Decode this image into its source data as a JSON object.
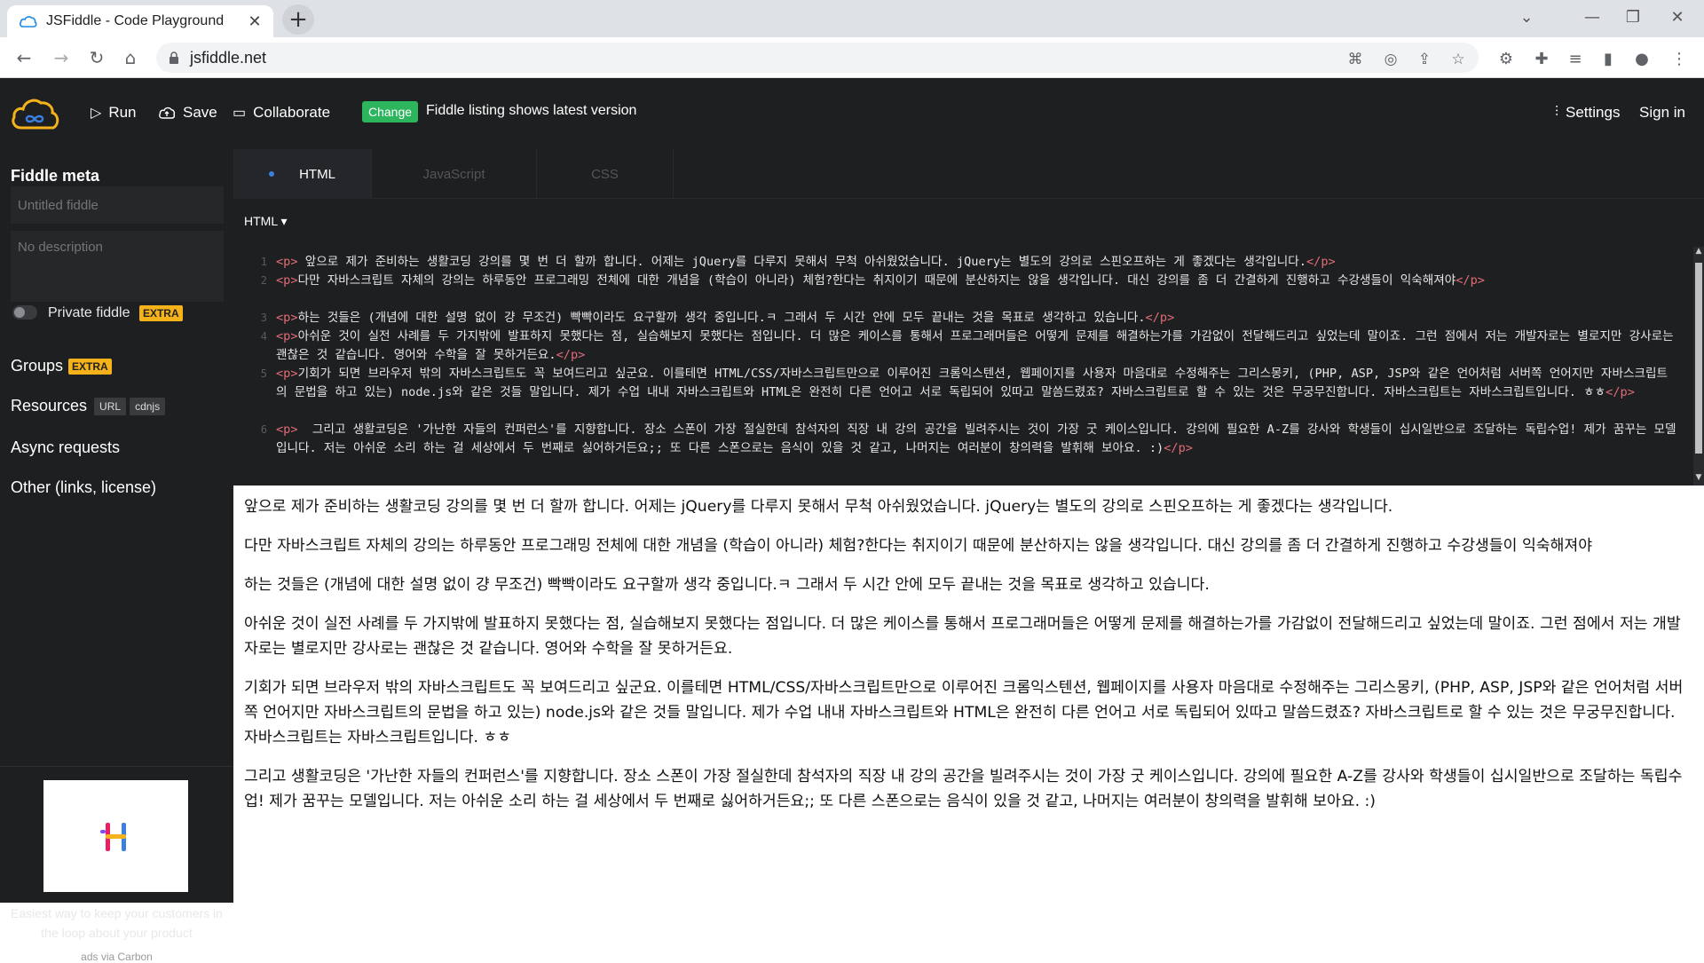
{
  "browser": {
    "tab_title": "JSFiddle - Code Playground",
    "url": "jsfiddle.net"
  },
  "topbar": {
    "run_label": "Run",
    "save_label": "Save",
    "collaborate_label": "Collaborate",
    "change_badge": "Change",
    "change_text": "Fiddle listing shows latest version",
    "settings_label": "Settings",
    "signin_label": "Sign in"
  },
  "sidebar": {
    "title": "Fiddle meta",
    "title_placeholder": "Untitled fiddle",
    "description_placeholder": "No description",
    "private_label": "Private fiddle",
    "extra_badge": "EXTRA",
    "groups_label": "Groups",
    "resources_label": "Resources",
    "resources_pills": [
      "URL",
      "cdnjs"
    ],
    "async_label": "Async requests",
    "other_label": "Other (links, license)",
    "ad_text": "Easiest way to keep your customers in the loop about your product",
    "ad_via": "ads via Carbon"
  },
  "editor": {
    "tabs": [
      "HTML",
      "JavaScript",
      "CSS"
    ],
    "language": "HTML ▾",
    "lines": [
      {
        "num": "1",
        "text": " 앞으로 제가 준비하는 생활코딩 강의를 몇 번 더 할까 합니다. 어제는 jQuery를 다루지 못해서 무척 아쉬웠었습니다. jQuery는 별도의 강의로 스핀오프하는 게 좋겠다는 생각입니다."
      },
      {
        "num": "2",
        "text": "다만 자바스크립트 자체의 강의는 하루동안 프로그래밍 전체에 대한 개념을 (학습이 아니라) 체험?한다는 취지이기 때문에 분산하지는 않을 생각입니다. 대신 강의를 좀 더 간결하게 진행하고 수강생들이 익숙해져야"
      },
      {
        "num": "3",
        "text": "하는 것들은 (개념에 대한 설명 없이 걍 무조건) 빡빡이라도 요구할까 생각 중입니다.ㅋ 그래서 두 시간 안에 모두 끝내는 것을 목표로 생각하고 있습니다."
      },
      {
        "num": "4",
        "text": "아쉬운 것이 실전 사례를 두 가지밖에 발표하지 못했다는 점, 실습해보지 못했다는 점입니다. 더 많은 케이스를 통해서 프로그래머들은 어떻게 문제를 해결하는가를 가감없이 전달해드리고 싶었는데 말이죠. 그런 점에서 저는 개발자로는 별로지만 강사로는 괜찮은 것 같습니다. 영어와 수학을 잘 못하거든요."
      },
      {
        "num": "5",
        "text": "기회가 되면 브라우저 밖의 자바스크립트도 꼭 보여드리고 싶군요. 이를테면 HTML/CSS/자바스크립트만으로 이루어진 크롬익스텐션, 웹페이지를 사용자 마음대로 수정해주는 그리스몽키, (PHP, ASP, JSP와 같은 언어처럼 서버쪽 언어지만 자바스크립트의 문법을 하고 있는) node.js와 같은 것들 말입니다. 제가 수업 내내 자바스크립트와 HTML은 완전히 다른 언어고 서로 독립되어 있따고 말씀드렸죠? 자바스크립트로 할 수 있는 것은 무궁무진합니다. 자바스크립트는 자바스크립트입니다. ㅎㅎ"
      },
      {
        "num": "6",
        "text": "  그리고 생활코딩은 '가난한 자들의 컨퍼런스'를 지향합니다. 장소 스폰이 가장 절실한데 참석자의 직장 내 강의 공간을 빌려주시는 것이 가장 굿 케이스입니다. 강의에 필요한 A-Z를 강사와 학생들이 십시일반으로 조달하는 독립수업! 제가 꿈꾸는 모델입니다. 저는 아쉬운 소리 하는 걸 세상에서 두 번째로 싫어하거든요;; 또 다른 스폰으로는 음식이 있을 것 같고, 나머지는 여러분이 창의력을 발휘해 보아요. :)"
      }
    ],
    "tag_open": "<p>",
    "tag_close": "</p>"
  },
  "result": {
    "paragraphs": [
      "앞으로 제가 준비하는 생활코딩 강의를 몇 번 더 할까 합니다. 어제는 jQuery를 다루지 못해서 무척 아쉬웠었습니다. jQuery는 별도의 강의로 스핀오프하는 게 좋겠다는 생각입니다.",
      "다만 자바스크립트 자체의 강의는 하루동안 프로그래밍 전체에 대한 개념을 (학습이 아니라) 체험?한다는 취지이기 때문에 분산하지는 않을 생각입니다. 대신 강의를 좀 더 간결하게 진행하고 수강생들이 익숙해져야",
      "하는 것들은 (개념에 대한 설명 없이 걍 무조건) 빡빡이라도 요구할까 생각 중입니다.ㅋ 그래서 두 시간 안에 모두 끝내는 것을 목표로 생각하고 있습니다.",
      "아쉬운 것이 실전 사례를 두 가지밖에 발표하지 못했다는 점, 실습해보지 못했다는 점입니다. 더 많은 케이스를 통해서 프로그래머들은 어떻게 문제를 해결하는가를 가감없이 전달해드리고 싶었는데 말이죠. 그런 점에서 저는 개발자로는 별로지만 강사로는 괜찮은 것 같습니다. 영어와 수학을 잘 못하거든요.",
      "기회가 되면 브라우저 밖의 자바스크립트도 꼭 보여드리고 싶군요. 이를테면 HTML/CSS/자바스크립트만으로 이루어진 크롬익스텐션, 웹페이지를 사용자 마음대로 수정해주는 그리스몽키, (PHP, ASP, JSP와 같은 언어처럼 서버쪽 언어지만 자바스크립트의 문법을 하고 있는) node.js와 같은 것들 말입니다. 제가 수업 내내 자바스크립트와 HTML은 완전히 다른 언어고 서로 독립되어 있따고 말씀드렸죠? 자바스크립트로 할 수 있는 것은 무궁무진합니다. 자바스크립트는 자바스크립트입니다. ㅎㅎ",
      "그리고 생활코딩은 '가난한 자들의 컨퍼런스'를 지향합니다. 장소 스폰이 가장 절실한데 참석자의 직장 내 강의 공간을 빌려주시는 것이 가장 굿 케이스입니다. 강의에 필요한 A-Z를 강사와 학생들이 십시일반으로 조달하는 독립수업! 제가 꿈꾸는 모델입니다. 저는 아쉬운 소리 하는 걸 세상에서 두 번째로 싫어하거든요;; 또 다른 스폰으로는 음식이 있을 것 같고, 나머지는 여러분이 창의력을 발휘해 보아요. :)"
    ]
  },
  "colors": {
    "app_bg": "#1e1f21",
    "change_badge": "#2cb55d",
    "extra_badge": "#f5b21b",
    "tag": "#e06c75",
    "active_dot": "#3b7fe0"
  }
}
